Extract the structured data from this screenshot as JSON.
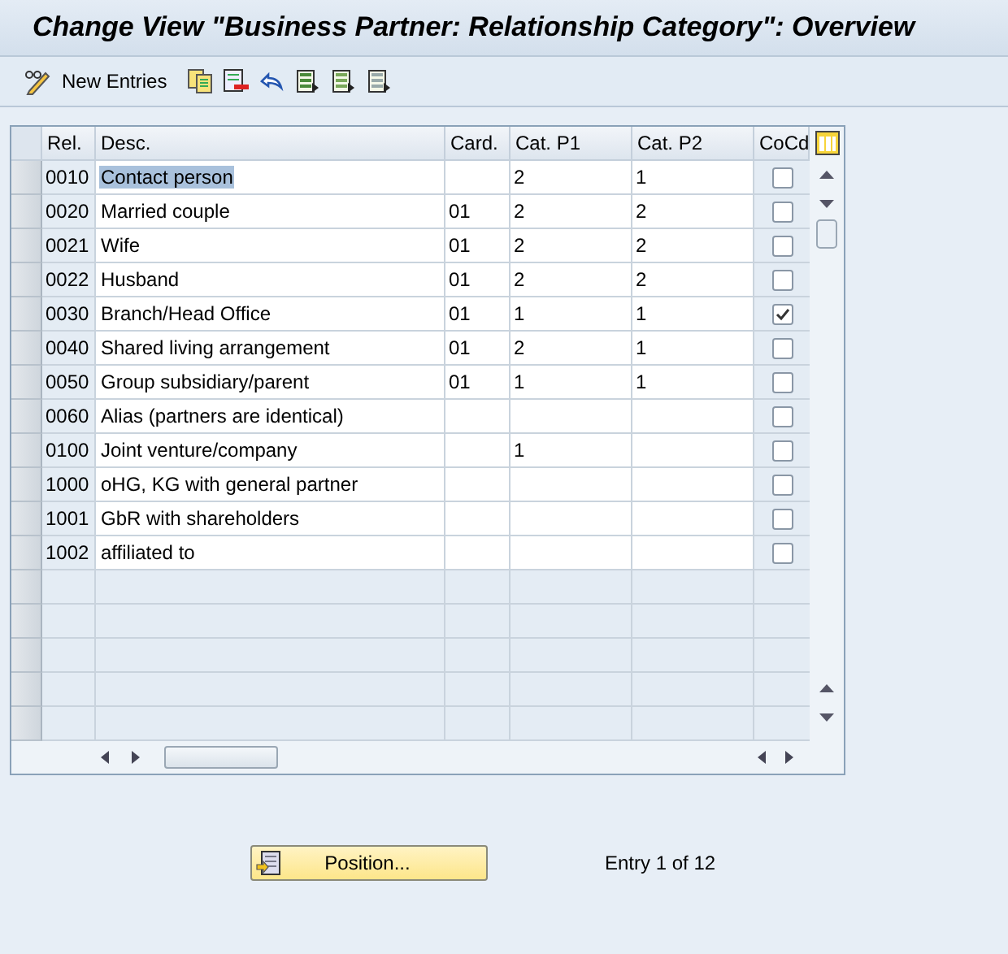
{
  "window": {
    "title": "Change View \"Business Partner: Relationship Category\": Overview"
  },
  "toolbar": {
    "new_entries": "New Entries"
  },
  "table": {
    "columns": [
      "Rel.",
      "Desc.",
      "Card.",
      "Cat. P1",
      "Cat. P2",
      "CoCd"
    ],
    "rows": [
      {
        "rel": "0010",
        "desc": "Contact person",
        "card": "",
        "cat_p1": "2",
        "cat_p2": "1",
        "cocd": false,
        "highlighted": true
      },
      {
        "rel": "0020",
        "desc": "Married couple",
        "card": "01",
        "cat_p1": "2",
        "cat_p2": "2",
        "cocd": false,
        "highlighted": false
      },
      {
        "rel": "0021",
        "desc": "Wife",
        "card": "01",
        "cat_p1": "2",
        "cat_p2": "2",
        "cocd": false,
        "highlighted": false
      },
      {
        "rel": "0022",
        "desc": "Husband",
        "card": "01",
        "cat_p1": "2",
        "cat_p2": "2",
        "cocd": false,
        "highlighted": false
      },
      {
        "rel": "0030",
        "desc": "Branch/Head Office",
        "card": "01",
        "cat_p1": "1",
        "cat_p2": "1",
        "cocd": true,
        "highlighted": false
      },
      {
        "rel": "0040",
        "desc": "Shared living arrangement",
        "card": "01",
        "cat_p1": "2",
        "cat_p2": "1",
        "cocd": false,
        "highlighted": false
      },
      {
        "rel": "0050",
        "desc": "Group subsidiary/parent",
        "card": "01",
        "cat_p1": "1",
        "cat_p2": "1",
        "cocd": false,
        "highlighted": false
      },
      {
        "rel": "0060",
        "desc": "Alias (partners are identical)",
        "card": "",
        "cat_p1": "",
        "cat_p2": "",
        "cocd": false,
        "highlighted": false
      },
      {
        "rel": "0100",
        "desc": "Joint venture/company",
        "card": "",
        "cat_p1": "1",
        "cat_p2": "",
        "cocd": false,
        "highlighted": false
      },
      {
        "rel": "1000",
        "desc": "oHG, KG with general partner",
        "card": "",
        "cat_p1": "",
        "cat_p2": "",
        "cocd": false,
        "highlighted": false
      },
      {
        "rel": "1001",
        "desc": "GbR with shareholders",
        "card": "",
        "cat_p1": "",
        "cat_p2": "",
        "cocd": false,
        "highlighted": false
      },
      {
        "rel": "1002",
        "desc": "affiliated to",
        "card": "",
        "cat_p1": "",
        "cat_p2": "",
        "cocd": false,
        "highlighted": false
      }
    ]
  },
  "footer": {
    "position_button": "Position...",
    "entry_info": "Entry 1 of 12"
  }
}
